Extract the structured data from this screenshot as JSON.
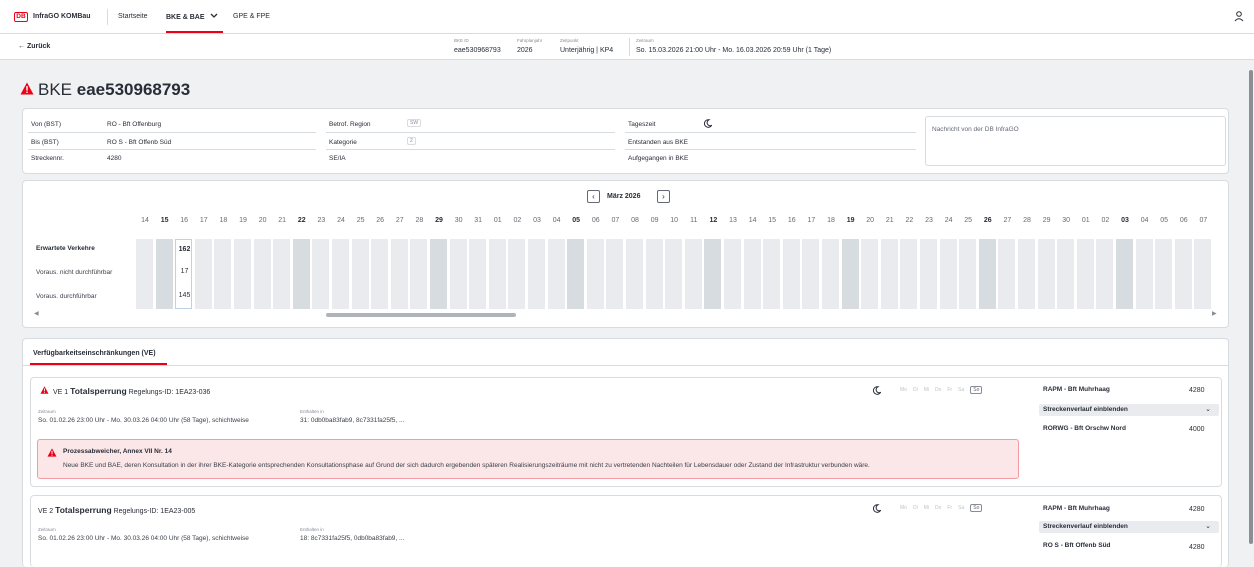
{
  "app": {
    "logo_text": "DB",
    "name": "InfraGO KOMBau"
  },
  "nav": [
    {
      "label": "Startseite"
    },
    {
      "label": "BKE & BAE"
    },
    {
      "label": "GPE & FPE"
    }
  ],
  "subbar": {
    "back": "← Zurück",
    "meta": [
      {
        "label": "BKE ID",
        "value": "eae530968793"
      },
      {
        "label": "Fahrplanjahr",
        "value": "2026"
      },
      {
        "label": "Zeitpunkt",
        "value": "Unterjährig | KP4"
      },
      {
        "label": "Zeitraum",
        "value": "So. 15.03.2026 21:00 Uhr - Mo. 16.03.2026 20:59 Uhr (1 Tage)"
      }
    ]
  },
  "title": {
    "prefix": "BKE",
    "id": "eae530968793"
  },
  "info": {
    "col1": [
      {
        "label": "Von (BST)",
        "value": "RO - Bft Offenburg"
      },
      {
        "label": "Bis (BST)",
        "value": "RO S - Bft Offenb Süd"
      },
      {
        "label": "Streckennr.",
        "value": "4280"
      }
    ],
    "col2": [
      {
        "label": "Betrof. Region",
        "chip": "SW"
      },
      {
        "label": "Kategorie",
        "chip": "2"
      },
      {
        "label": "SE/IA",
        "chip": ""
      }
    ],
    "col3": [
      {
        "label": "Tageszeit"
      },
      {
        "label": "Entstanden aus BKE"
      },
      {
        "label": "Aufgegangen in BKE"
      }
    ],
    "message_placeholder": "Nachricht von der DB InfraGO"
  },
  "calendar": {
    "month": "März 2026",
    "days": [
      "14",
      "15",
      "16",
      "17",
      "18",
      "19",
      "20",
      "21",
      "22",
      "23",
      "24",
      "25",
      "26",
      "27",
      "28",
      "29",
      "30",
      "31",
      "01",
      "02",
      "03",
      "04",
      "05",
      "06",
      "07",
      "08",
      "09",
      "10",
      "11",
      "12",
      "13",
      "14",
      "15",
      "16",
      "17",
      "18",
      "19",
      "20",
      "21",
      "22",
      "23",
      "24",
      "25",
      "26",
      "27",
      "28",
      "29",
      "30",
      "01",
      "02",
      "03",
      "04",
      "05",
      "06",
      "07"
    ],
    "bold_days": [
      1,
      8,
      15,
      22,
      29,
      36,
      43,
      50
    ],
    "selected_index": 2,
    "rows": [
      {
        "label": "Erwartete Verkehre",
        "value": "162"
      },
      {
        "label": "Voraus. nicht durchführbar",
        "value": "17"
      },
      {
        "label": "Voraus. durchführbar",
        "value": "145"
      }
    ]
  },
  "ve_tab": "Verfügbarkeitseinschränkungen (VE)",
  "ve": [
    {
      "num": "VE 1",
      "type": "Totalsperrung",
      "reg": "Regelungs-ID: 1EA23-036",
      "zeitraum_label": "Zeitraum",
      "zeitraum": "So. 01.02.26 23:00 Uhr - Mo. 30.03.26 04:00 Uhr (58 Tage), schichtweise",
      "enth_label": "Enthalten in",
      "enth": "31: 0db0ba83fab9, 8c7331fa25f5, ...",
      "weekdays": [
        "Mo",
        "Di",
        "Mi",
        "Do",
        "Fr",
        "Sa",
        "So"
      ],
      "from": "RAPM - Bft Muhrhaag",
      "from_nr": "4280",
      "toggle": "Streckenverlauf einblenden",
      "to": "RORWG - Bft Orschw Nord",
      "to_nr": "4000",
      "alert_title": "Prozessabweicher, Annex VII Nr. 14",
      "alert_text": "Neue BKE und BAE, deren Konsultation in der ihrer BKE-Kategorie entsprechenden Konsultationsphase auf Grund der sich dadurch ergebenden späteren Realisierungszeiträume mit nicht zu vertretenden Nachteilen für Lebensdauer oder Zustand der Infrastruktur verbunden wäre."
    },
    {
      "num": "VE 2",
      "type": "Totalsperrung",
      "reg": "Regelungs-ID: 1EA23-005",
      "zeitraum_label": "Zeitraum",
      "zeitraum": "So. 01.02.26 23:00 Uhr - Mo. 30.03.26 04:00 Uhr (58 Tage), schichtweise",
      "enth_label": "Enthalten in",
      "enth": "18: 8c7331fa25f5, 0db0ba83fab9, ...",
      "weekdays": [
        "Mo",
        "Di",
        "Mi",
        "Do",
        "Fr",
        "Sa",
        "So"
      ],
      "from": "RAPM - Bft Muhrhaag",
      "from_nr": "4280",
      "toggle": "Streckenverlauf einblenden",
      "to": "RO S - Bft Offenb Süd",
      "to_nr": "4280"
    }
  ],
  "colors": {
    "brand_red": "#ec0016",
    "alert_bg": "#fbe6e8"
  },
  "icons": [
    "db-logo",
    "user-icon",
    "chevron-down-icon",
    "warning-icon",
    "moon-icon"
  ]
}
